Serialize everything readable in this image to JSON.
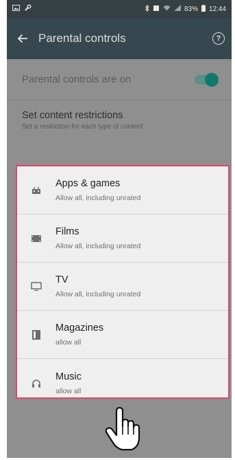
{
  "status_bar": {
    "battery": "83%",
    "time": "12:44"
  },
  "app_bar": {
    "title": "Parental controls"
  },
  "toggle": {
    "label": "Parental controls are on",
    "state": "on"
  },
  "restrictions": {
    "heading": "Set content restrictions",
    "subheading": "Set a restriction for each type of content"
  },
  "items": [
    {
      "title": "Apps & games",
      "desc": "Allow all, including unrated",
      "icon": "apps-games-icon"
    },
    {
      "title": "Films",
      "desc": "Allow all, including unrated",
      "icon": "films-icon"
    },
    {
      "title": "TV",
      "desc": "Allow all, including unrated",
      "icon": "tv-icon"
    },
    {
      "title": "Magazines",
      "desc": "allow all",
      "icon": "magazines-icon"
    },
    {
      "title": "Music",
      "desc": "allow all",
      "icon": "music-icon"
    }
  ],
  "colors": {
    "app_bar": "#37474f",
    "toggle_on": "#0e7b6a",
    "highlight_border": "#e2446b"
  }
}
